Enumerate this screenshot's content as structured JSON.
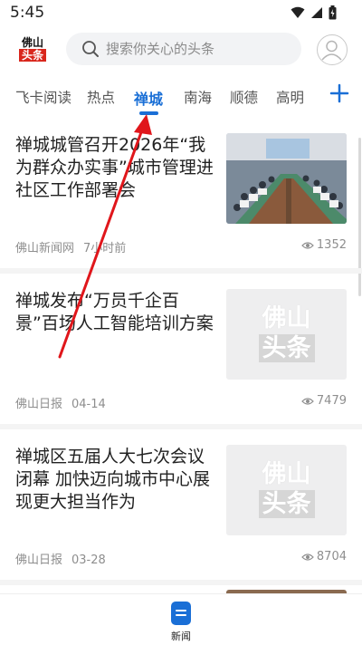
{
  "status_bar": {
    "time": "5:45"
  },
  "header": {
    "logo_line1": "佛山",
    "logo_line2": "头条",
    "search_placeholder": "搜索你关心的头条"
  },
  "tabs": [
    {
      "label": "飞卡阅读",
      "active": false
    },
    {
      "label": "热点",
      "active": false
    },
    {
      "label": "禅城",
      "active": true
    },
    {
      "label": "南海",
      "active": false
    },
    {
      "label": "顺德",
      "active": false
    },
    {
      "label": "高明",
      "active": false
    }
  ],
  "news": [
    {
      "title": "禅城城管召开2026年“我为群众办实事”城市管理进社区工作部署会",
      "source": "佛山新闻网",
      "time": "7小时前",
      "views": "1352",
      "thumb": "photo"
    },
    {
      "title": "禅城发布“万员千企百景”百场人工智能培训方案",
      "source": "佛山日报",
      "time": "04-14",
      "views": "7479",
      "thumb": "placeholder"
    },
    {
      "title": "禅城区五届人大七次会议闭幕 加快迈向城市中心展现更大担当作为",
      "source": "佛山日报",
      "time": "03-28",
      "views": "8704",
      "thumb": "placeholder"
    }
  ],
  "placeholder_logo": {
    "line1": "佛山",
    "line2": "头条"
  },
  "bottom_nav": {
    "label": "新闻"
  },
  "colors": {
    "accent": "#1a6fd6",
    "annotation": "#e0161b",
    "brand_red": "#d9261c"
  },
  "icons": [
    "search-icon",
    "avatar-icon",
    "plus-icon",
    "eye-icon",
    "news-icon",
    "wifi-icon",
    "signal-icon",
    "battery-icon"
  ]
}
